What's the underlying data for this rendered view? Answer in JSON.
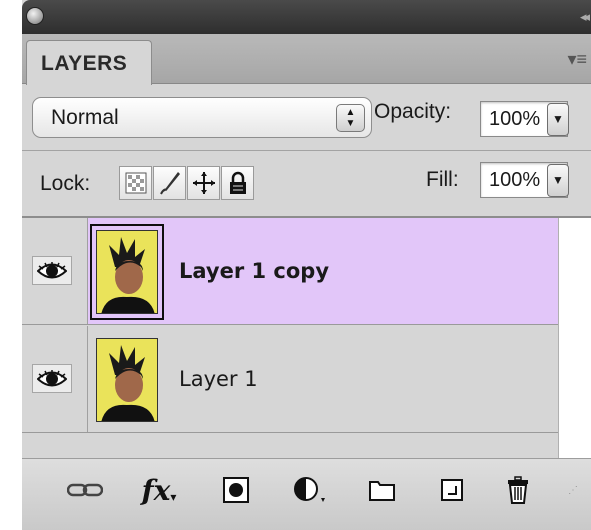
{
  "panel": {
    "tab_label": "LAYERS"
  },
  "blend": {
    "mode": "Normal",
    "opacity_label": "Opacity:",
    "opacity_value": "100%"
  },
  "lock": {
    "label": "Lock:",
    "fill_label": "Fill:",
    "fill_value": "100%"
  },
  "layers": [
    {
      "name": "Layer 1 copy",
      "selected": true,
      "visible": true
    },
    {
      "name": "Layer 1",
      "selected": false,
      "visible": true
    }
  ],
  "colors": {
    "selected_row": "#e2c6f9",
    "panel_bg": "#d6d6d6",
    "thumbnail_bg": "#f4f26a"
  },
  "toolbar_icons": [
    "link-layers-icon",
    "fx-icon",
    "layer-mask-icon",
    "adjustment-layer-icon",
    "folder-icon",
    "new-layer-icon",
    "trash-icon"
  ]
}
